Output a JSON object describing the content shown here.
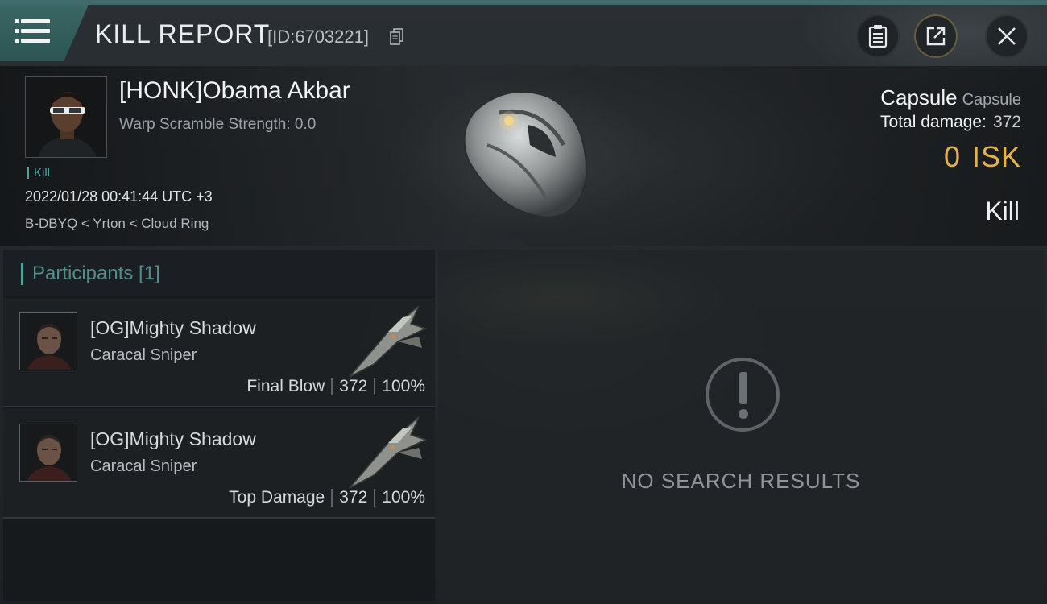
{
  "header": {
    "title": "KILL REPORT",
    "report_id": "[ID:6703221]"
  },
  "victim": {
    "name": "[HONK]Obama Akbar",
    "warp_scramble": "Warp Scramble Strength: 0.0",
    "tag": "Kill",
    "datetime": "2022/01/28 00:41:44 UTC +3",
    "location": "B-DBYQ < Yrton < Cloud Ring",
    "ship_name": "Capsule",
    "ship_class": "Capsule",
    "total_damage_label": "Total damage:",
    "total_damage": "372",
    "isk_value": "0",
    "isk_unit": "ISK",
    "result": "Kill"
  },
  "participants": {
    "title": "Participants [1]",
    "rows": [
      {
        "name": "[OG]Mighty Shadow",
        "ship": "Caracal Sniper",
        "role": "Final Blow",
        "damage": "372",
        "percent": "100%"
      },
      {
        "name": "[OG]Mighty Shadow",
        "ship": "Caracal Sniper",
        "role": "Top Damage",
        "damage": "372",
        "percent": "100%"
      }
    ]
  },
  "results": {
    "empty_text": "NO SEARCH RESULTS"
  },
  "colors": {
    "accent": "#4fa39c",
    "isk": "#e3b24d",
    "topbar": "#3f6c6a"
  }
}
